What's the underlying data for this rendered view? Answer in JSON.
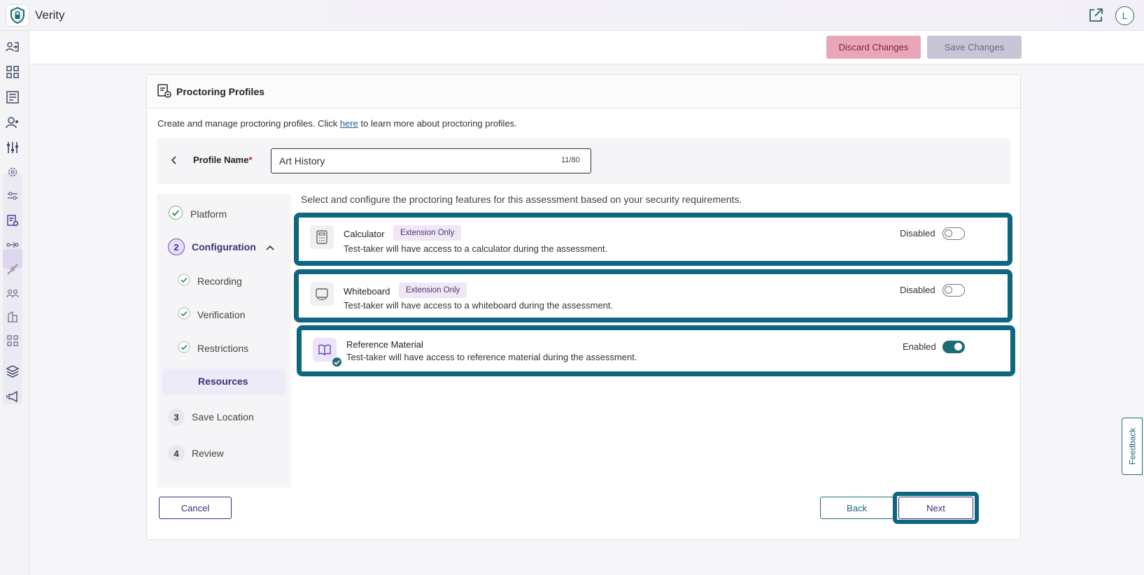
{
  "app": {
    "title": "Verity",
    "avatar_initial": "L"
  },
  "toolbar": {
    "discard_label": "Discard Changes",
    "save_label": "Save Changes"
  },
  "card": {
    "title": "Proctoring Profiles",
    "intro_before": "Create and manage proctoring profiles. Click ",
    "intro_link": "here",
    "intro_after": " to learn more about proctoring profiles."
  },
  "profile": {
    "label": "Profile Name",
    "required_mark": "*",
    "value": "Art History",
    "count": "11/80"
  },
  "steps": {
    "platform": "Platform",
    "configuration_num": "2",
    "configuration": "Configuration",
    "recording": "Recording",
    "verification": "Verification",
    "restrictions": "Restrictions",
    "resources": "Resources",
    "save_location_num": "3",
    "save_location": "Save Location",
    "review_num": "4",
    "review": "Review"
  },
  "main": {
    "description": "Select and configure the proctoring features for this assessment based on your security requirements.",
    "features": [
      {
        "title": "Calculator",
        "tag": "Extension Only",
        "desc": "Test-taker will have access to a calculator during the assessment.",
        "state": "Disabled",
        "enabled": false,
        "icon": "calculator-icon"
      },
      {
        "title": "Whiteboard",
        "tag": "Extension Only",
        "desc": "Test-taker will have access to a whiteboard during the assessment.",
        "state": "Disabled",
        "enabled": false,
        "icon": "whiteboard-icon"
      },
      {
        "title": "Reference Material",
        "tag": "",
        "desc": "Test-taker will have access to reference material during the assessment.",
        "state": "Enabled",
        "enabled": true,
        "icon": "book-icon"
      }
    ]
  },
  "footer": {
    "cancel": "Cancel",
    "back": "Back",
    "next": "Next"
  },
  "feedback": "Feedback",
  "colors": {
    "accent": "#1d6b74",
    "highlight": "#0f6680",
    "primary": "#3e2d7a",
    "discard_bg": "#e8a7b9"
  }
}
